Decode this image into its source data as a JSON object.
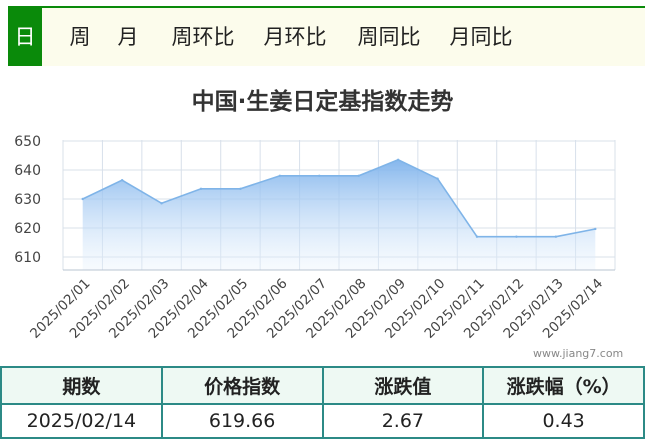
{
  "tabs": [
    "日",
    "周",
    "月",
    "周环比",
    "月环比",
    "周同比",
    "月同比"
  ],
  "chart_title": "中国·生姜日定基指数走势",
  "watermark": "www.jiang7.com",
  "colors": {
    "accent": "#0a8a0a",
    "line": "#7fb4e8",
    "area_top": "#8dbdf0",
    "table_border": "#2c8a86"
  },
  "chart_data": {
    "type": "area",
    "title": "中国·生姜日定基指数走势",
    "x": [
      "2025/02/01",
      "2025/02/02",
      "2025/02/03",
      "2025/02/04",
      "2025/02/05",
      "2025/02/06",
      "2025/02/07",
      "2025/02/08",
      "2025/02/09",
      "2025/02/10",
      "2025/02/11",
      "2025/02/12",
      "2025/02/13",
      "2025/02/14"
    ],
    "values": [
      630.0,
      636.5,
      628.5,
      633.5,
      633.5,
      638.0,
      638.0,
      638.0,
      643.5,
      637.0,
      617.0,
      617.0,
      617.0,
      619.66
    ],
    "ylim": [
      610,
      650
    ],
    "yticks": [
      610,
      620,
      630,
      640,
      650
    ],
    "grid": true,
    "legend": "none"
  },
  "summary": {
    "headers": [
      "期数",
      "价格指数",
      "涨跌值",
      "涨跌幅（%）"
    ],
    "row": [
      "2025/02/14",
      "619.66",
      "2.67",
      "0.43"
    ]
  }
}
